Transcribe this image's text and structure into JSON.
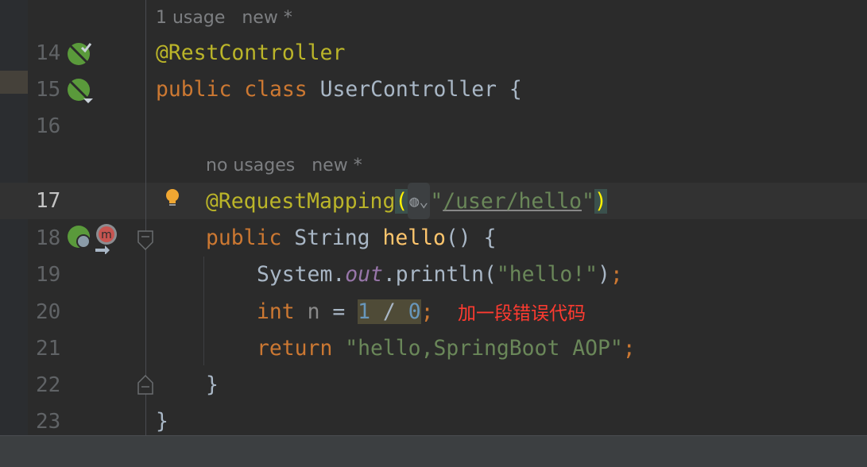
{
  "line_numbers": [
    "14",
    "15",
    "16",
    "17",
    "18",
    "19",
    "20",
    "21",
    "22",
    "23"
  ],
  "hints": {
    "class_usage": "1 usage   new *",
    "method_usage": "no usages   new *"
  },
  "code": {
    "l14": "@RestController",
    "l15_kw": "public class ",
    "l15_name": "UserController {",
    "l17_ann": "@RequestMapping",
    "l17_open": "(",
    "l17_q1": "\"",
    "l17_url": "/user/hello",
    "l17_q2": "\"",
    "l17_close": ")",
    "l17_chip": "◍⌄",
    "l18_kw": "public ",
    "l18_type": "String ",
    "l18_fn": "hello",
    "l18_rest": "() {",
    "l19_a": "System.",
    "l19_field": "out",
    "l19_b": ".println(",
    "l19_str": "\"hello!\"",
    "l19_c": ")",
    "l19_semi": ";",
    "l20_kw": "int ",
    "l20_var": "n",
    "l20_eq": " = ",
    "l20_expr_a": "1",
    "l20_expr_op": " / ",
    "l20_expr_b": "0",
    "l20_semi": ";",
    "l21_kw": "return ",
    "l21_str": "\"hello,SpringBoot AOP\"",
    "l21_semi": ";",
    "l22": "}",
    "l23": "}"
  },
  "annotation_note": "加一段错误代码",
  "colors": {
    "error_note": "#ff3b30",
    "bean_icon": "#5a9a3b",
    "mapping_icon": "#c75450",
    "bulb": "#f0a732"
  }
}
